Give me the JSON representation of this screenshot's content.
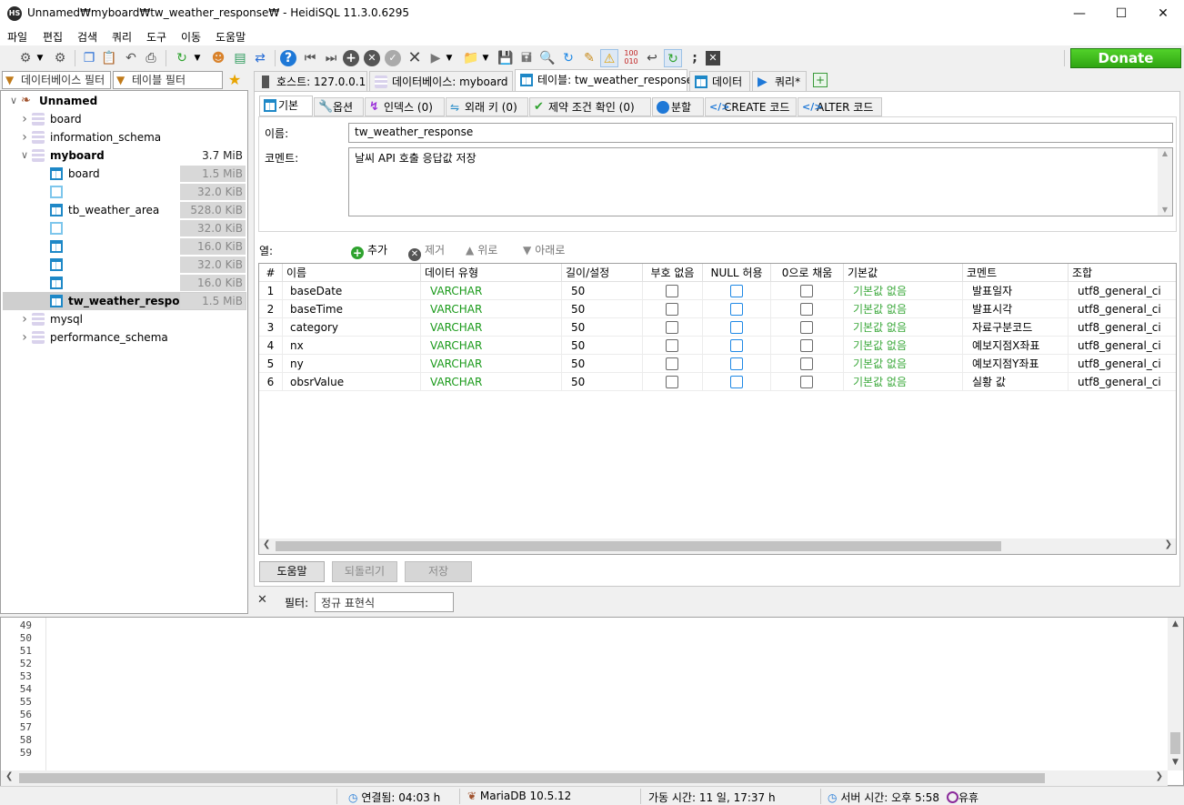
{
  "window": {
    "title": "Unnamed₩myboard₩tw_weather_response₩ - HeidiSQL 11.3.0.6295",
    "app_icon_text": "HS"
  },
  "menu": [
    "파일",
    "편집",
    "검색",
    "쿼리",
    "도구",
    "이동",
    "도움말"
  ],
  "toolbar": {
    "donate_label": "Donate"
  },
  "left_panel": {
    "db_filter_placeholder": "데이터베이스 필터",
    "table_filter_placeholder": "테이블 필터",
    "tree": [
      {
        "label": "Unnamed",
        "size": "",
        "level": 0,
        "type": "server",
        "expanded": true
      },
      {
        "label": "board",
        "size": "",
        "level": 1,
        "type": "db",
        "expanded": false
      },
      {
        "label": "information_schema",
        "size": "",
        "level": 1,
        "type": "db",
        "expanded": false
      },
      {
        "label": "myboard",
        "size": "3.7 MiB",
        "level": 1,
        "type": "db",
        "expanded": true
      },
      {
        "label": "board",
        "size": "1.5 MiB",
        "level": 2,
        "type": "table"
      },
      {
        "label": "",
        "size": "32.0 KiB",
        "level": 2,
        "type": "table-empty"
      },
      {
        "label": "tb_weather_area",
        "size": "528.0 KiB",
        "level": 2,
        "type": "table"
      },
      {
        "label": "",
        "size": "32.0 KiB",
        "level": 2,
        "type": "table-empty"
      },
      {
        "label": "",
        "size": "16.0 KiB",
        "level": 2,
        "type": "table"
      },
      {
        "label": "",
        "size": "32.0 KiB",
        "level": 2,
        "type": "table"
      },
      {
        "label": "",
        "size": "16.0 KiB",
        "level": 2,
        "type": "table"
      },
      {
        "label": "tw_weather_respon...",
        "size": "1.5 MiB",
        "level": 2,
        "type": "table",
        "selected": true
      },
      {
        "label": "mysql",
        "size": "",
        "level": 1,
        "type": "db",
        "expanded": false
      },
      {
        "label": "performance_schema",
        "size": "",
        "level": 1,
        "type": "db",
        "expanded": false
      }
    ]
  },
  "main_tabs": [
    {
      "label": "호스트: 127.0.0.1"
    },
    {
      "label": "데이터베이스: myboard"
    },
    {
      "label": "테이블: tw_weather_response"
    },
    {
      "label": "데이터"
    },
    {
      "label": "쿼리*"
    }
  ],
  "sub_tabs": [
    {
      "label": "기본"
    },
    {
      "label": "옵션"
    },
    {
      "label": "인덱스 (0)"
    },
    {
      "label": "외래 키 (0)"
    },
    {
      "label": "제약 조건 확인 (0)"
    },
    {
      "label": "분할"
    },
    {
      "label": "CREATE 코드"
    },
    {
      "label": "ALTER 코드"
    }
  ],
  "form": {
    "name_label": "이름:",
    "name_value": "tw_weather_response",
    "comment_label": "코멘트:",
    "comment_value": "날씨 API 호출 응답값 저장"
  },
  "columns_bar": {
    "label": "열:",
    "add": "추가",
    "remove": "제거",
    "up": "위로",
    "down": "아래로"
  },
  "grid": {
    "headers": [
      "#",
      "이름",
      "데이터 유형",
      "길이/설정",
      "부호 없음",
      "NULL 허용",
      "0으로 채움",
      "기본값",
      "코멘트",
      "조합"
    ],
    "rows": [
      {
        "n": "1",
        "name": "baseDate",
        "type": "VARCHAR",
        "len": "50",
        "default": "기본값 없음",
        "comment": "발표일자",
        "collation": "utf8_general_ci"
      },
      {
        "n": "2",
        "name": "baseTime",
        "type": "VARCHAR",
        "len": "50",
        "default": "기본값 없음",
        "comment": "발표시각",
        "collation": "utf8_general_ci"
      },
      {
        "n": "3",
        "name": "category",
        "type": "VARCHAR",
        "len": "50",
        "default": "기본값 없음",
        "comment": "자료구분코드",
        "collation": "utf8_general_ci"
      },
      {
        "n": "4",
        "name": "nx",
        "type": "VARCHAR",
        "len": "50",
        "default": "기본값 없음",
        "comment": "예보지점X좌표",
        "collation": "utf8_general_ci"
      },
      {
        "n": "5",
        "name": "ny",
        "type": "VARCHAR",
        "len": "50",
        "default": "기본값 없음",
        "comment": "예보지점Y좌표",
        "collation": "utf8_general_ci"
      },
      {
        "n": "6",
        "name": "obsrValue",
        "type": "VARCHAR",
        "len": "50",
        "default": "기본값 없음",
        "comment": "실황 값",
        "collation": "utf8_general_ci"
      }
    ]
  },
  "buttons": {
    "help": "도움말",
    "revert": "되돌리기",
    "save": "저장"
  },
  "filter": {
    "label": "필터:",
    "placeholder": "정규 표현식"
  },
  "log_lines": [
    "49",
    "50",
    "51",
    "52",
    "53",
    "54",
    "55",
    "56",
    "57",
    "58",
    "59"
  ],
  "status": {
    "connected": "연결됨: 04:03 h",
    "server": "MariaDB 10.5.12",
    "uptime": "가동 시간: 11 일, 17:37 h",
    "server_time": "서버 시간: 오후 5:58",
    "idle": "유휴"
  },
  "colors": {
    "accent_blue": "#1e88c7",
    "type_green": "#1a9a1a",
    "default_green": "#3aa83a",
    "donate_green": "#3cbc1c"
  }
}
